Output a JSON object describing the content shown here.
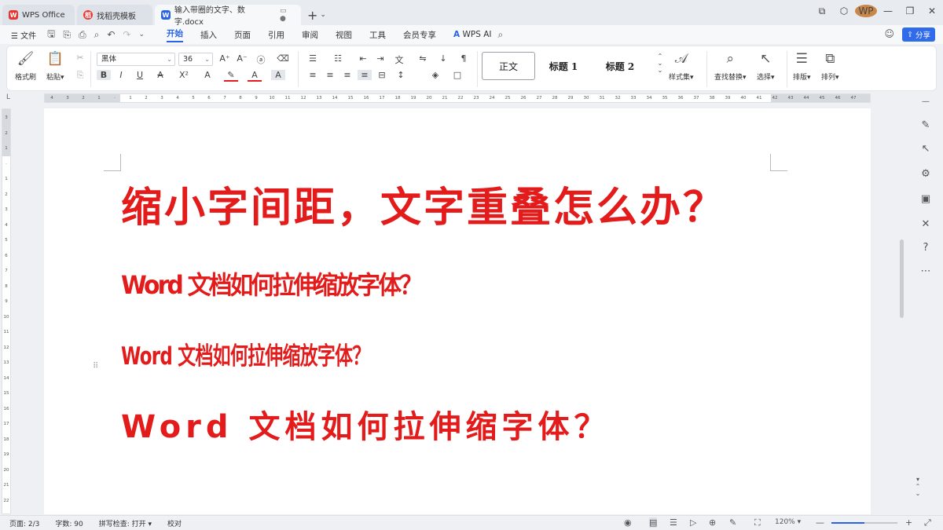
{
  "tabs": [
    {
      "label": "WPS Office",
      "icon": "wps-logo-icon",
      "color": "#e8352f",
      "active": false
    },
    {
      "label": "找稻壳模板",
      "icon": "docer-icon",
      "color": "#e8352f",
      "active": false
    },
    {
      "label": "输入带圈的文字、数字.docx",
      "icon": "word-doc-icon",
      "color": "#2b62e8",
      "active": true
    }
  ],
  "menu": {
    "file": "文件",
    "items": [
      "开始",
      "插入",
      "页面",
      "引用",
      "审阅",
      "视图",
      "工具",
      "会员专享"
    ],
    "active": "开始",
    "wps_ai": "WPS AI",
    "share": "分享"
  },
  "ribbon": {
    "format_painter": "格式刷",
    "paste": "粘贴",
    "font_name": "黑体",
    "font_size": "36",
    "styles": [
      "正文",
      "标题 1",
      "标题 2"
    ],
    "style_set": "样式集",
    "find_replace": "查找替换",
    "select": "选择",
    "layout": "排版",
    "arrange": "排列"
  },
  "ruler": {
    "h_ticks": [
      "4",
      "3",
      "2",
      "1",
      "",
      "1",
      "2",
      "3",
      "4",
      "5",
      "6",
      "7",
      "8",
      "9",
      "10",
      "11",
      "12",
      "13",
      "14",
      "15",
      "16",
      "17",
      "18",
      "19",
      "20",
      "21",
      "22",
      "23",
      "24",
      "25",
      "26",
      "27",
      "28",
      "29",
      "30",
      "31",
      "32",
      "33",
      "34",
      "35",
      "36",
      "37",
      "38",
      "39",
      "40",
      "41",
      "42",
      "43",
      "44",
      "45",
      "46",
      "47"
    ],
    "v_ticks": [
      "3",
      "2",
      "1",
      "",
      "1",
      "2",
      "3",
      "4",
      "5",
      "6",
      "7",
      "8",
      "9",
      "10",
      "11",
      "12",
      "13",
      "14",
      "15",
      "16",
      "17",
      "18",
      "19",
      "20",
      "21",
      "22"
    ]
  },
  "document": {
    "line1": "缩小字间距，文字重叠怎么办？",
    "line2": "Word 文档如何拉伸缩放字体？",
    "line3": "Word 文档如何拉伸缩放字体？",
    "line4": "Word 文档如何拉伸缩字体？",
    "text_color": "#e31b1b"
  },
  "status": {
    "page": "页面: 2/3",
    "words": "字数: 90",
    "spell": "拼写检查: 打开",
    "proof": "校对",
    "zoom": "120%",
    "zoom_level": 0.5
  },
  "colors": {
    "accent": "#2b62e8",
    "share_bg": "#2f6bea"
  }
}
